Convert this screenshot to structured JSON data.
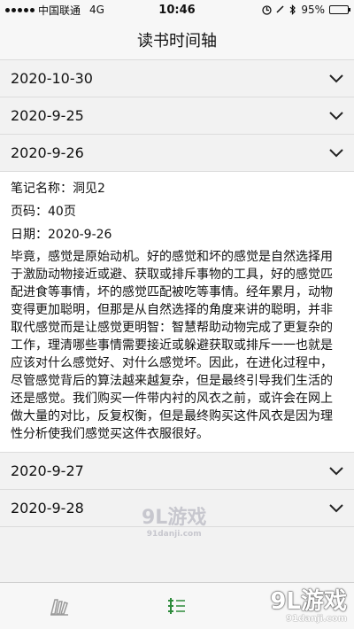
{
  "status_bar": {
    "carrier": "中国联通",
    "network": "4G",
    "time": "10:46",
    "battery_percent": "95%",
    "battery_level": 0.95
  },
  "nav": {
    "title": "读书时间轴"
  },
  "entries": [
    {
      "date": "2020-10-30",
      "expanded": false
    },
    {
      "date": "2020-9-25",
      "expanded": false
    },
    {
      "date": "2020-9-26",
      "expanded": true,
      "note_name": "笔记名称：洞见2",
      "page": "页码：40页",
      "date_line": "日期：2020-9-26",
      "content": "毕竟，感觉是原始动机。好的感觉和坏的感觉是自然选择用于激励动物接近或避、获取或排斥事物的工具，好的感觉匹配进食等事情，坏的感觉匹配被吃等事情。经年累月，动物变得更加聪明，但那是从自然选择的角度来讲的聪明，并非取代感觉而是让感觉更明智：智慧帮助动物完成了更复杂的工作，理清哪些事情需要接近或躲避获取或排斥一一也就是应该对什么感觉好、对什么感觉坏。因此，在进化过程中，尽管感觉背后的算法越来越复杂，但是最终引导我们生活的还是感觉。我们购买一件带内衬的风衣之前，或许会在网上做大量的对比，反复权衡，但是最终购买这件风衣是因为理性分析使我们感觉买这件衣服很好。"
    },
    {
      "date": "2020-9-27",
      "expanded": false
    },
    {
      "date": "2020-9-28",
      "expanded": false
    }
  ],
  "watermark": {
    "main": "9L游戏",
    "sub": "91danji.com"
  },
  "colors": {
    "background": "#f2f2f2",
    "detail_bg": "#ffffff",
    "tab_active": "#2e8b3c"
  }
}
